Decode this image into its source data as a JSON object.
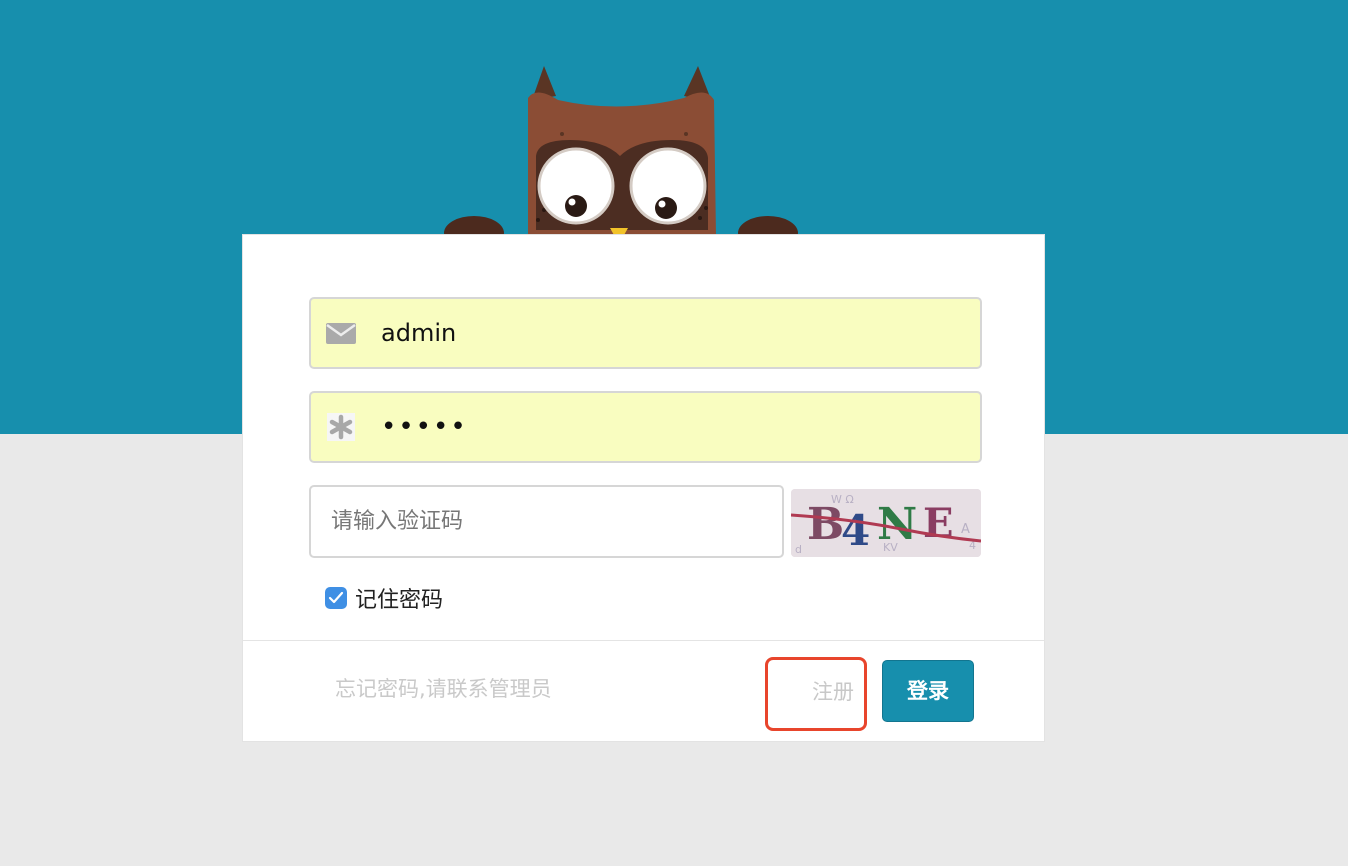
{
  "login_form": {
    "username_value": "admin",
    "password_value": "•••••",
    "captcha_placeholder": "请输入验证码",
    "captcha_image_text": "B4NE",
    "remember_label": "记住密码",
    "remember_checked": true,
    "forgot_text": "忘记密码,请联系管理员",
    "register_label": "注册",
    "login_label": "登录"
  },
  "icons": {
    "username": "envelope-icon",
    "password": "asterisk-icon",
    "checkbox": "checkmark-icon",
    "mascot": "owl-mascot"
  },
  "colors": {
    "header_band": "#178fad",
    "background": "#e9e9e9",
    "autofill_field": "#f9fdc0",
    "checkbox": "#3f8fe4",
    "login_button": "#178fad",
    "highlight_border": "#e8452c"
  }
}
